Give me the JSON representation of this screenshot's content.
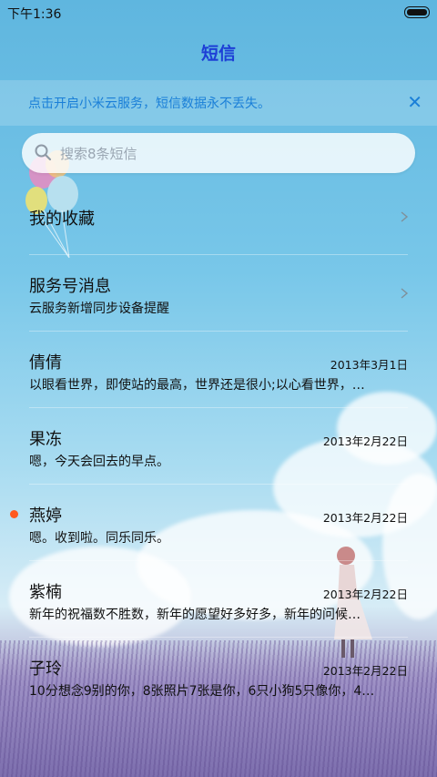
{
  "status": {
    "time": "下午1:36"
  },
  "header": {
    "title": "短信"
  },
  "banner": {
    "text": "点击开启小米云服务，短信数据永不丢失。"
  },
  "search": {
    "placeholder": "搜索8条短信"
  },
  "favorites": {
    "label": "我的收藏"
  },
  "service": {
    "title": "服务号消息",
    "subtitle": "云服务新增同步设备提醒"
  },
  "conversations": [
    {
      "name": "倩倩",
      "date": "2013年3月1日",
      "preview": "以眼看世界，即使站的最高，世界还是很小;以心看世界，…",
      "unread": false
    },
    {
      "name": "果冻",
      "date": "2013年2月22日",
      "preview": "嗯，今天会回去的早点。",
      "unread": false
    },
    {
      "name": "燕婷",
      "date": "2013年2月22日",
      "preview": "嗯。收到啦。同乐同乐。",
      "unread": true
    },
    {
      "name": "紫楠",
      "date": "2013年2月22日",
      "preview": "新年的祝福数不胜数，新年的愿望好多好多，新年的问候…",
      "unread": false
    },
    {
      "name": "子玲",
      "date": "2013年2月22日",
      "preview": "10分想念9别的你，8张照片7张是你，6只小狗5只像你，4…",
      "unread": false
    }
  ],
  "colors": {
    "accent": "#1a7fd8",
    "title": "#1d3fd6",
    "unread": "#ff5a1f"
  },
  "icons": {
    "search": "search-icon",
    "close": "close-icon",
    "chevron": "chevron-right-icon"
  }
}
